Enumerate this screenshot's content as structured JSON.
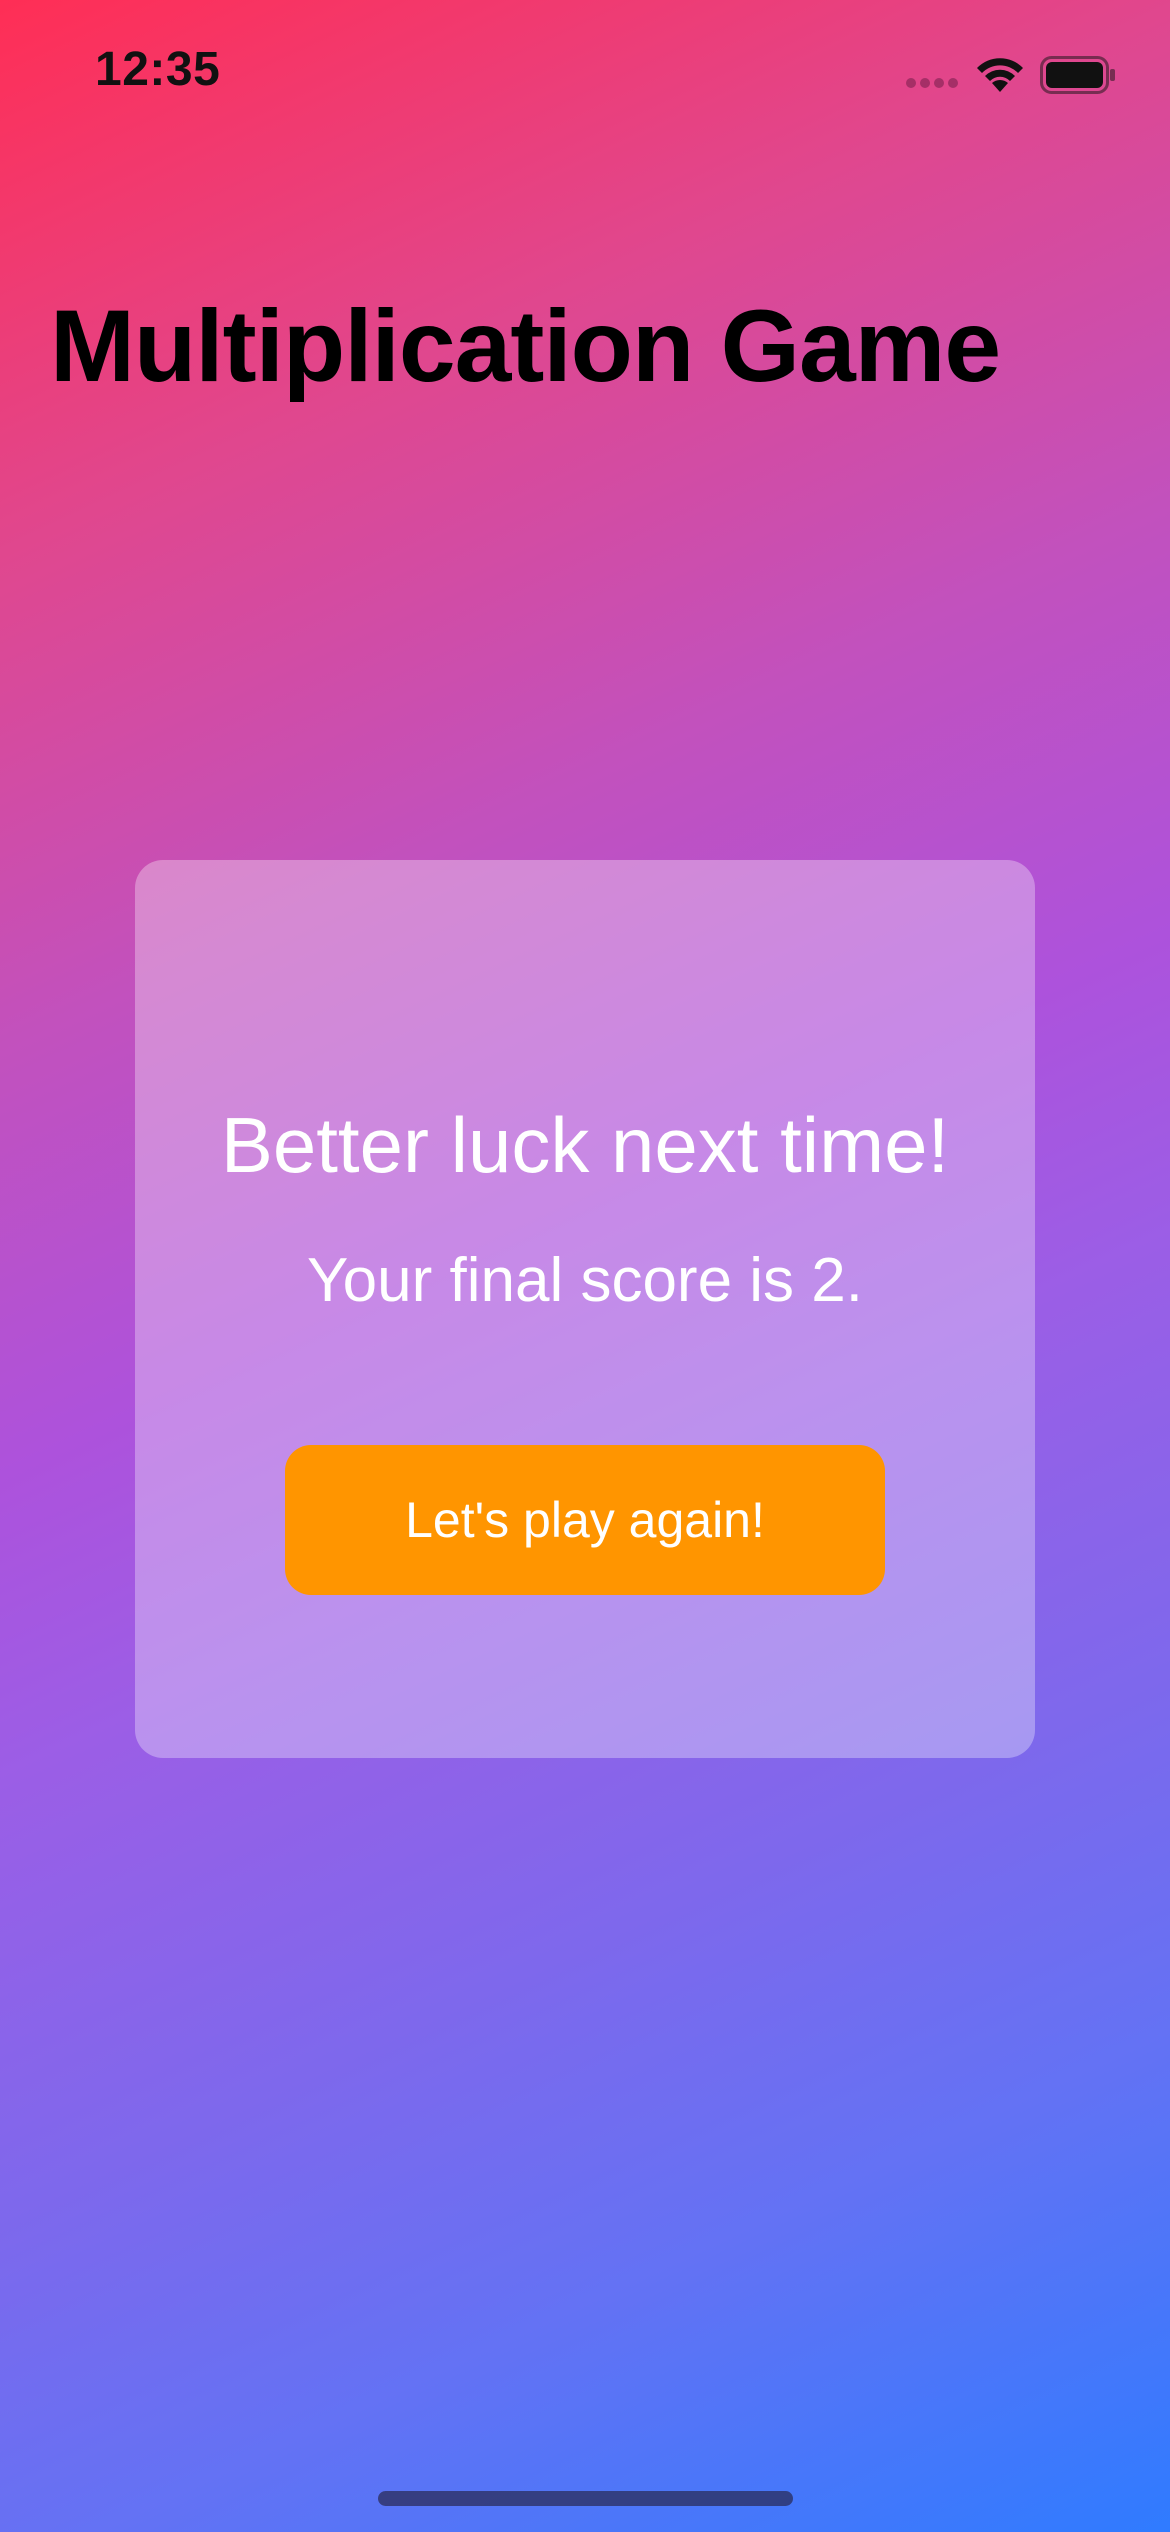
{
  "status_bar": {
    "time": "12:35",
    "icons": [
      "signal-icon",
      "wifi-icon",
      "battery-icon"
    ]
  },
  "page": {
    "title": "Multiplication Game"
  },
  "result_card": {
    "heading": "Better luck next time!",
    "score_text": "Your final score is 2.",
    "button_label": "Let's play again!"
  },
  "colors": {
    "button": "#ff9500",
    "gradient_start": "#ff2e55",
    "gradient_mid": "#ad52dc",
    "gradient_end": "#2f7bff",
    "text_primary": "#000000",
    "text_on_card": "#ffffff"
  }
}
